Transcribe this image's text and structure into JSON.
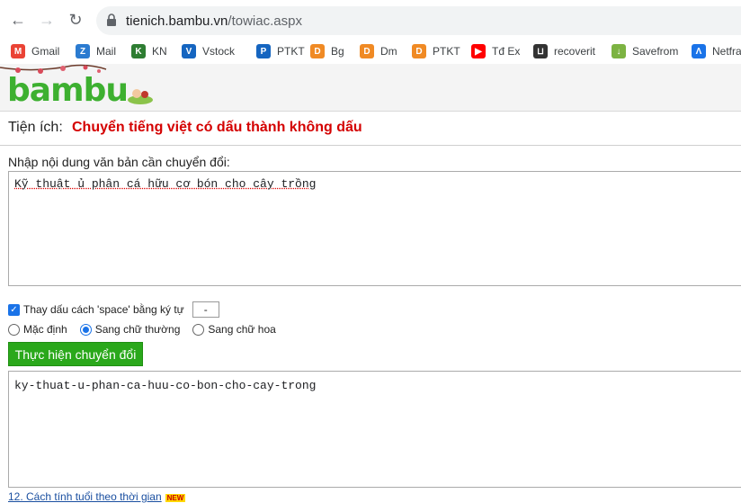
{
  "browser": {
    "url_host": "tienich.bambu.vn",
    "url_path": "/towiac.aspx",
    "bookmarks": [
      {
        "label": "Gmail",
        "icon": "gmail-icon",
        "color": "#ea4335"
      },
      {
        "label": "Mail",
        "icon": "mail-icon",
        "color": "#2b7bd0"
      },
      {
        "label": "KN",
        "icon": "kn-icon",
        "color": "#2e7d32"
      },
      {
        "label": "Vstock",
        "icon": "vstock-icon",
        "color": "#1565c0"
      },
      {
        "label": "PTKT",
        "icon": "ptkt-icon",
        "color": "#1565c0"
      },
      {
        "label": "Bg",
        "icon": "d-icon",
        "color": "#f08a24"
      },
      {
        "label": "Dm",
        "icon": "d-icon",
        "color": "#f08a24"
      },
      {
        "label": "PTKT",
        "icon": "d-icon",
        "color": "#f08a24"
      },
      {
        "label": "Tđ Ex",
        "icon": "youtube-icon",
        "color": "#ff0000"
      },
      {
        "label": "recoverit",
        "icon": "recoverit-icon",
        "color": "#333333"
      },
      {
        "label": "Savefrom",
        "icon": "savefrom-icon",
        "color": "#7cb342"
      },
      {
        "label": "Netfra",
        "icon": "netfra-icon",
        "color": "#1a73e8"
      }
    ]
  },
  "page": {
    "logo": "bambu",
    "title_label": "Tiện ích:",
    "title_text": "Chuyển tiếng việt có dấu thành không dấu",
    "input_label": "Nhập nội dung văn bản cần chuyển đổi:",
    "input_value": "Kỹ thuật ủ phân cá hữu cơ bón cho cây trồng",
    "replace_space_label": "Thay dấu cách 'space' bằng ký tự",
    "replace_space_checked": true,
    "separator_value": "-",
    "radio_options": [
      "Mặc định",
      "Sang chữ thường",
      "Sang chữ hoa"
    ],
    "radio_selected": 1,
    "convert_button": "Thực hiện chuyển đổi",
    "output_value": "ky-thuat-u-phan-ca-huu-co-bon-cho-cay-trong",
    "footer_link": "12. Cách tính tuổi theo thời gian",
    "footer_badge": "NEW"
  }
}
